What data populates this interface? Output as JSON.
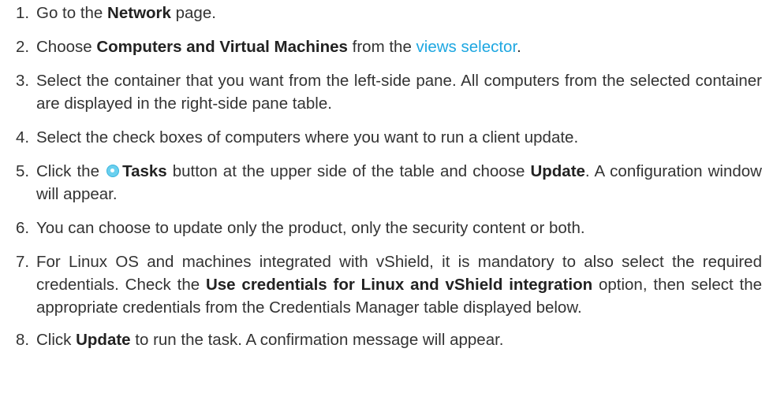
{
  "steps": [
    {
      "num": "1.",
      "a": "Go to the ",
      "b": "Network",
      "c": " page."
    },
    {
      "num": "2.",
      "a": "Choose ",
      "b": "Computers and Virtual Machines",
      "c": " from the ",
      "link": "views selector",
      "d": "."
    },
    {
      "num": "3.",
      "text": "Select the container that you want from the left-side pane. All computers from the selected container are displayed in the right-side pane table."
    },
    {
      "num": "4.",
      "text": "Select the check boxes of computers where you want to run a client update."
    },
    {
      "num": "5.",
      "a": "Click the ",
      "b": "Tasks",
      "c": " button at the upper side of the table and choose ",
      "d": "Update",
      "e": ". A configuration window will appear."
    },
    {
      "num": "6.",
      "text": "You can choose to update only the product, only the security content or both."
    },
    {
      "num": "7.",
      "a": "For Linux OS and machines integrated with vShield, it is mandatory to also select the required credentials. Check the ",
      "b": "Use credentials for Linux and vShield integration",
      "c": " option, then select the appropriate credentials from the Credentials Manager table displayed below."
    },
    {
      "num": "8.",
      "a": "Click ",
      "b": "Update",
      "c": " to run the task. A confirmation message will appear."
    }
  ],
  "icons": {
    "tasks": "tasks-icon"
  },
  "colors": {
    "link": "#1ea7e1",
    "text": "#333333"
  }
}
